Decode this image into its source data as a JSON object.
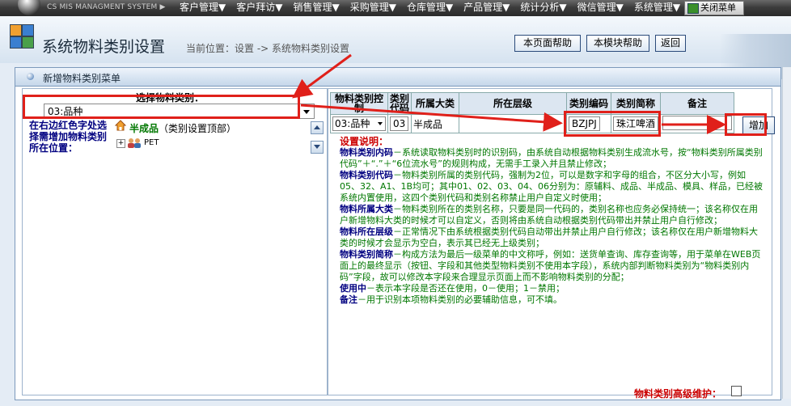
{
  "topbar": {
    "system_name": "CS MIS MANAGMENT SYSTEM ▶",
    "menu": [
      "客户管理▼",
      "客户拜访▼",
      "销售管理▼",
      "采购管理▼",
      "仓库管理▼",
      "产品管理▼",
      "统计分析▼",
      "微信管理▼",
      "系统管理▼"
    ],
    "close_menu_label": "关闭菜单"
  },
  "header": {
    "title": "系统物料类别设置",
    "breadcrumb": "当前位置：设置 -> 系统物料类别设置",
    "buttons": {
      "page_help": "本页面帮助",
      "module_help": "本模块帮助",
      "back": "返回"
    }
  },
  "panel": {
    "title": "新增物料类别菜单",
    "left": {
      "select_label": "选择物料类别：",
      "selected_category": "03:品种",
      "hint": "在右边红色字处选择需增加物料类别所在位置：",
      "tree": {
        "root_name": "半成品",
        "root_note": "（类别设置顶部）",
        "child": "PET"
      }
    },
    "right": {
      "columns": [
        "物料类别控制",
        "类别代码",
        "所属大类",
        "所在层级",
        "类别编码",
        "类别简称",
        "备注"
      ],
      "row": {
        "control": "03:品种",
        "code": "03",
        "category": "半成品",
        "level": "",
        "type_code": "BZJPJ",
        "type_short": "珠江啤酒",
        "remark": ""
      },
      "add_button": "增加",
      "notes_title": "设置说明：",
      "notes": [
        {
          "term": "物料类别内码",
          "text": "－系统读取物料类别时的识别码，由系统自动根据物料类别生成流水号，按“物料类别所属类别代码”＋“.”＋“6位流水号”的规则构成，无需手工录入并且禁止修改；"
        },
        {
          "term": "物料类别代码",
          "text": "－物料类别所属的类别代码，强制为2位，可以是数字和字母的组合，不区分大小写，例如05、32、A1、1B均可；其中01、02、03、04、06分别为：原辅料、成品、半成品、模具、样品，已经被系统内置使用，这四个类别代码和类别名称禁止用户自定义时使用；"
        },
        {
          "term": "物料所属大类",
          "text": "－物料类别所在的类别名称，只要是同一代码的，类别名称也应务必保持统一；该名称仅在用户新增物料大类的时候才可以自定义，否则将由系统自动根据类别代码带出并禁止用户自行修改；"
        },
        {
          "term": "物料所在层级",
          "text": "－正常情况下由系统根据类别代码自动带出并禁止用户自行修改；该名称仅在用户新增物料大类的时候才会显示为空白，表示其已经无上级类别；"
        },
        {
          "term": "物料类别简称",
          "text": "－构成方法为最后一级菜单的中文称呼，例如：送货单查询、库存查询等，用于菜单在WEB页面上的最终显示（按钮、字段和其他类型物料类别不使用本字段），系统内部判断物料类别为“物料类别内码”字段，故可以修改本字段来合理显示页面上而不影响物料类别的分配；"
        },
        {
          "term": "使用中",
          "text": "－表示本字段是否还在使用，0－使用；1－禁用；"
        },
        {
          "term": "备注",
          "text": "－用于识别本项物料类别的必要辅助信息，可不填。"
        }
      ]
    },
    "footer_label": "物料类别高级维护："
  },
  "colors": {
    "highlight_red": "#e0201a",
    "tree_green": "#007700",
    "note_red": "#cc0000",
    "note_green": "#007700",
    "topbar": "#3c3c3c"
  }
}
